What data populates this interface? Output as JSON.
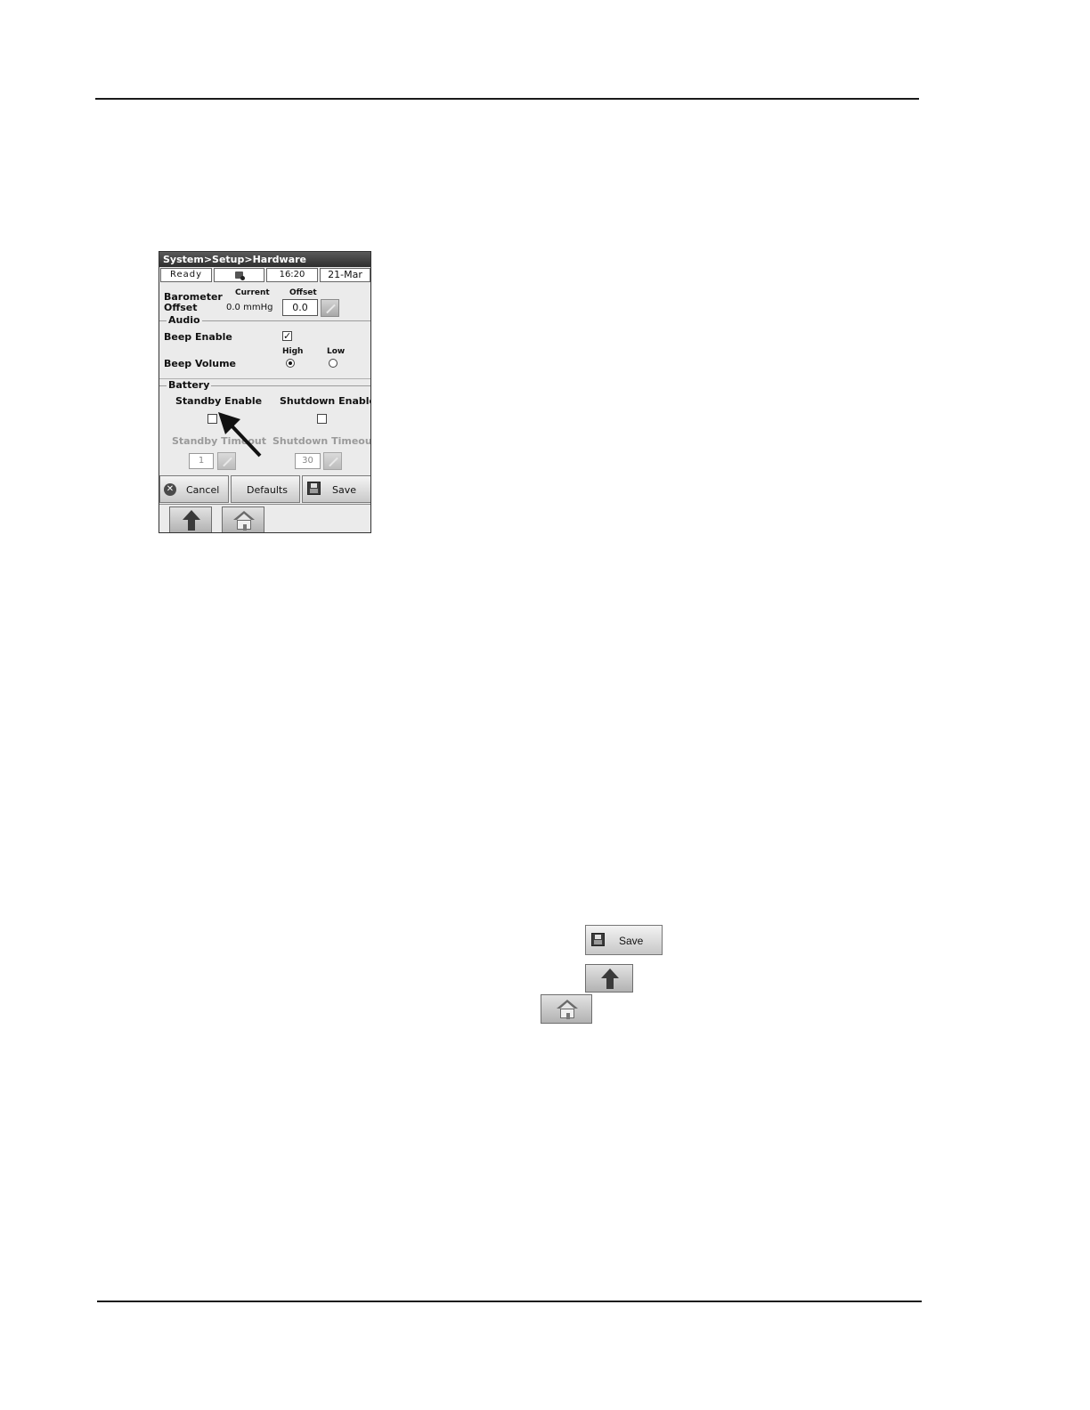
{
  "screen": {
    "breadcrumb": "System>Setup>Hardware",
    "status": {
      "state": "Ready",
      "time": "16:20",
      "date": "21-Mar",
      "device_icon": "device-status-icon"
    },
    "barometer": {
      "label_line1": "Barometer",
      "label_line2": "Offset",
      "current_header": "Current",
      "offset_header": "Offset",
      "current_value": "0.0 mmHg",
      "offset_value": "0.0"
    },
    "audio": {
      "group_title": "Audio",
      "beep_enable_label": "Beep Enable",
      "beep_enable_checked": true,
      "beep_volume_label": "Beep Volume",
      "high_label": "High",
      "low_label": "Low",
      "selected_volume": "High"
    },
    "battery": {
      "group_title": "Battery",
      "standby_enable_label": "Standby Enable",
      "shutdown_enable_label": "Shutdown Enable",
      "standby_enable_checked": false,
      "shutdown_enable_checked": false,
      "standby_timeout_label": "Standby Timeout",
      "shutdown_timeout_label": "Shutdown Timeout",
      "standby_timeout_value": "1",
      "shutdown_timeout_value": "30"
    },
    "buttons": {
      "cancel": "Cancel",
      "defaults": "Defaults",
      "save": "Save"
    },
    "nav": {
      "up_icon": "up-arrow-icon",
      "home_icon": "home-icon"
    }
  },
  "standalone": {
    "save_label": "Save",
    "up_icon": "up-arrow-icon",
    "home_icon": "home-icon"
  },
  "colors": {
    "titlebar": "#3a3a3a",
    "panel": "#ebebeb",
    "button": "#c9c9c9"
  }
}
